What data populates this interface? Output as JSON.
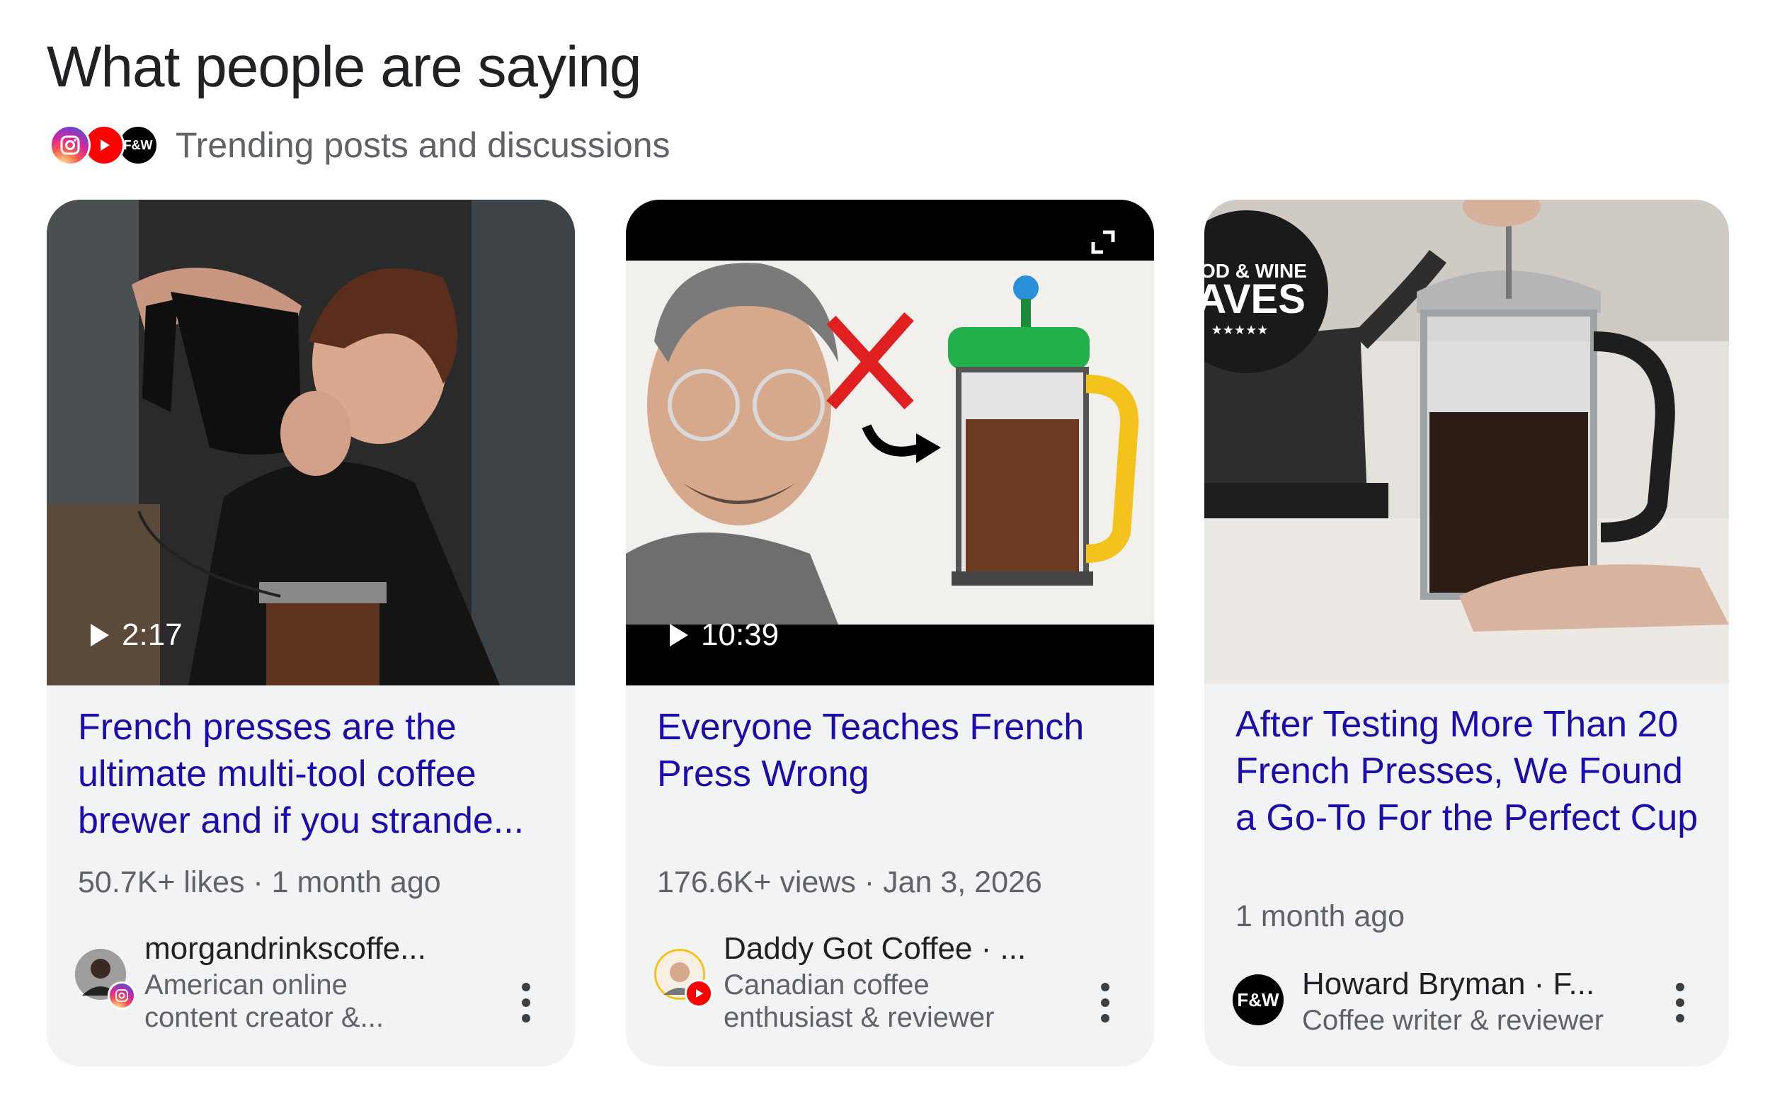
{
  "header": {
    "title": "What people are saying",
    "subtitle": "Trending posts and discussions",
    "source_icons": [
      "instagram-icon",
      "youtube-icon",
      "food-and-wine-icon"
    ],
    "fw_logo_text": "F&W"
  },
  "cards": [
    {
      "duration": "2:17",
      "title": "French presses are the ultimate multi-tool coffee brewer and if you strande...",
      "meta": "50.7K+ likes · 1 month ago",
      "author_name": "morgandrinkscoffe...",
      "author_desc": "American online content creator &...",
      "platform": "instagram"
    },
    {
      "duration": "10:39",
      "title": "Everyone Teaches French Press Wrong",
      "meta": "176.6K+ views · Jan 3, 2026",
      "author_name": "Daddy Got Coffee · ...",
      "author_desc": "Canadian coffee enthusiast & reviewer",
      "platform": "youtube"
    },
    {
      "badge_line1": "FOOD & WINE",
      "badge_line2": "FAVES",
      "badge_stars": "★★★★★",
      "title": "After Testing More Than 20 French Presses, We Found a Go-To For the Perfect Cup",
      "meta": "1 month ago",
      "author_name": "Howard Bryman · F...",
      "author_desc": "Coffee writer & reviewer",
      "avatar_text": "F&W",
      "platform": "food-and-wine"
    }
  ],
  "colors": {
    "link_blue": "#1a0dab",
    "card_bg": "#f1f3f4",
    "meta_gray": "#5f6368"
  }
}
